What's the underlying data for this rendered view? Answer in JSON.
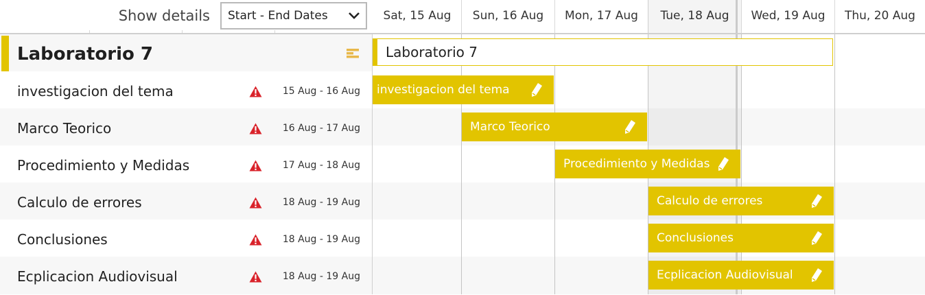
{
  "header": {
    "show_details_label": "Show details",
    "date_mode": "Start - End Dates",
    "days": [
      "Sat, 15 Aug",
      "Sun, 16 Aug",
      "Mon, 17 Aug",
      "Tue, 18 Aug",
      "Wed, 19 Aug",
      "Thu, 20 Aug"
    ],
    "today": "Tue, 18 Aug"
  },
  "group": {
    "title": "Laboratorio 7",
    "bar_label": "Laboratorio 7"
  },
  "tasks": [
    {
      "name": "investigacion del tema",
      "dates": "15 Aug - 16 Aug",
      "bar_label": "investigacion del tema",
      "warning": true
    },
    {
      "name": "Marco Teorico",
      "dates": "16 Aug - 17 Aug",
      "bar_label": "Marco Teorico",
      "warning": true
    },
    {
      "name": "Procedimiento y Medidas",
      "dates": "17 Aug - 18 Aug",
      "bar_label": "Procedimiento y Medidas",
      "warning": true
    },
    {
      "name": "Calculo de errores",
      "dates": "18 Aug - 19 Aug",
      "bar_label": "Calculo de errores",
      "warning": true
    },
    {
      "name": "Conclusiones",
      "dates": "18 Aug - 19 Aug",
      "bar_label": "Conclusiones",
      "warning": true
    },
    {
      "name": "Ecplicacion Audiovisual",
      "dates": "18 Aug - 19 Aug",
      "bar_label": "Ecplicacion Audiovisual",
      "warning": true
    }
  ],
  "colors": {
    "accent": "#e2c400",
    "warning": "#d9232b",
    "bar_text": "#ffffff"
  },
  "icons": {
    "select_chevron": "chevron-down-icon",
    "group_toggle": "gantt-collapse-icon",
    "task_warning": "warning-icon",
    "bar_edit": "pencil-icon"
  }
}
